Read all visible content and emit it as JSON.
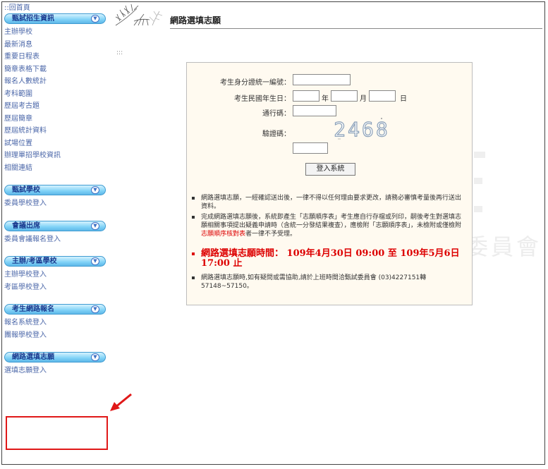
{
  "sidebar": {
    "home_link": "::回首頁",
    "sections": [
      {
        "header": "甄試招生資訊",
        "items": [
          "主辦學校",
          "最新消息",
          "重要日程表",
          "簡章表格下載",
          "報名人數統計",
          "考科範圍",
          "歷屆考古題",
          "歷屆簡章",
          "歷屆統計資料",
          "試場位置",
          "辦理單招學校資訊",
          "相關連結"
        ]
      },
      {
        "header": "甄試學校",
        "items": [
          "委員學校登入"
        ]
      },
      {
        "header": "會議出席",
        "items": [
          "委員會議報名登入"
        ]
      },
      {
        "header": "主辦/考區學校",
        "items": [
          "主辦學校登入",
          "考區學校登入"
        ]
      },
      {
        "header": "考生網路報名",
        "items": [
          "報名系統登入",
          "團報學校登入"
        ]
      },
      {
        "header": "網路選填志願",
        "items": [
          "選填志願登入"
        ]
      }
    ]
  },
  "page": {
    "title": "網路選填志願",
    "dots": ":::",
    "watermark": "委員會"
  },
  "form": {
    "id_label": "考生身分證統一編號：",
    "birth_label": "考生民國年生日：",
    "year_unit": "年",
    "month_unit": "月",
    "day_unit": "日",
    "pass_label": "通行碼：",
    "captcha_label": "驗證碼：",
    "captcha_value": "2468",
    "login_button": "登入系統"
  },
  "notes": {
    "note1": "網路選填志願，一經確認送出後，一律不得以任何理由要求更改，請務必審慎考量後再行送出資料。",
    "note2_part1": "完成網路選填志願後，系統即產生「志願順序表」考生應自行存檔或列印，嗣後考生對選填志願相關事項提出疑義申請時（含統一分發結果複查），應檢附「志願順序表」，未檢附或僅檢附",
    "note2_red": "志願順序核對表",
    "note2_part2": "者一律不予受理。",
    "deadline": "網路選填志願時間： 109年4月30日 09:00 至 109年5月6日 17:00 止",
    "contact": "網路選填志願時,如有疑問或需協助,請於上班時間洽甄試委員會 (03)4227151轉57148~57150。"
  },
  "colors": {
    "link": "#4a66a8",
    "header_gradient_start": "#d6f3ff",
    "header_gradient_end": "#5fb8e8",
    "deadline_red": "#dd0000",
    "highlight_red": "#e01818",
    "panel_bg": "#fffaf0"
  },
  "icons": {
    "section_toggle": "chevron-down-icon",
    "pine": "pine-branch-icon",
    "arrow": "red-arrow-icon"
  }
}
